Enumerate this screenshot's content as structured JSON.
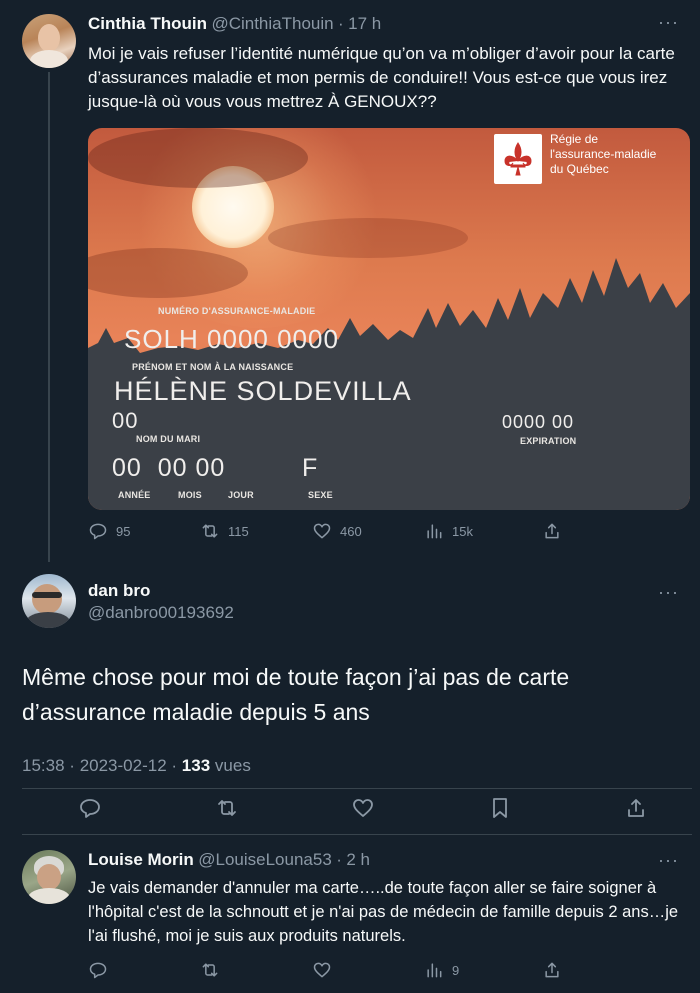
{
  "tweet1": {
    "name": "Cinthia Thouin",
    "handle": "@CinthiaThouin",
    "sep": "·",
    "time": "17 h",
    "more": "···",
    "text": "Moi je vais refuser l’identité numérique qu’on va m’obliger d’avoir pour la carte d’assurances maladie et mon permis de conduire!! Vous est-ce que vous irez jusque-là  où vous vous mettrez À GENOUX??",
    "replies": "95",
    "retweets": "115",
    "likes": "460",
    "views": "15k"
  },
  "card": {
    "logo_line1": "Régie de",
    "logo_line2": "l'assurance-maladie",
    "logo_line3": "du Québec",
    "nam_label": "NUMÉRO D'ASSURANCE-MALADIE",
    "nam_value": "SOLH 0000 0000",
    "name_label": "PRÉNOM ET NOM À LA NAISSANCE",
    "name_value": "HÉLÈNE SOLDEVILLA",
    "line00": "00",
    "husband_label": "NOM DU MARI",
    "date_value": "00  00 00",
    "sex_value": "F",
    "annee": "ANNÉE",
    "mois": "MOIS",
    "jour": "JOUR",
    "sexe": "SEXE",
    "exp_value": "0000 00",
    "exp_label": "EXPIRATION"
  },
  "tweet2": {
    "name": "dan bro",
    "handle": "@danbro00193692",
    "more": "···",
    "text": "Même chose pour moi de toute façon j’ai pas de carte d’assurance maladie depuis 5 ans",
    "time": "15:38",
    "date": "2023-02-12",
    "views_count": "133",
    "views_label": "vues",
    "sep": "·"
  },
  "tweet3": {
    "name": "Louise Morin",
    "handle": "@LouiseLouna53",
    "sep": "·",
    "time": "2 h",
    "more": "···",
    "text": "Je vais demander d'annuler ma carte…..de toute façon aller se faire soigner à l'hôpital c'est de la schnoutt et je n'ai pas de médecin de famille depuis 2 ans…je l'ai flushé, moi je suis aux produits naturels.",
    "views": "9"
  },
  "icons": [
    "reply-icon",
    "retweet-icon",
    "like-icon",
    "views-icon",
    "share-icon",
    "bookmark-icon",
    "more-icon"
  ]
}
